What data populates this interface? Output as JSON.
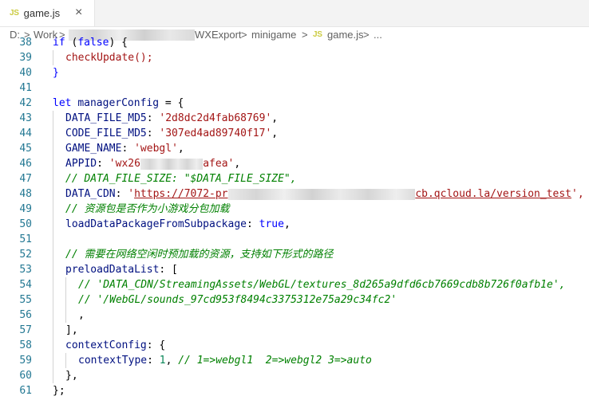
{
  "tab": {
    "icon": "JS",
    "label": "game.js",
    "close_icon": "×"
  },
  "breadcrumb": {
    "drive": "D:",
    "sep": ">",
    "folder1": "Work",
    "folder2": "WXExport",
    "folder3": "minigame",
    "file_icon": "JS",
    "file": "game.js",
    "more": "..."
  },
  "lines": [
    {
      "n": "38",
      "indent": 1,
      "tokens": [
        {
          "t": "if ",
          "c": "kw"
        },
        {
          "t": "(",
          "c": ""
        },
        {
          "t": "false",
          "c": "kw"
        },
        {
          "t": ") {",
          "c": ""
        }
      ]
    },
    {
      "n": "39",
      "indent": 2,
      "tokens": [
        {
          "t": "checkUpdate",
          "c": "str"
        },
        {
          "t": "();",
          "c": "str"
        }
      ]
    },
    {
      "n": "40",
      "indent": 1,
      "tokens": [
        {
          "t": "}",
          "c": "kw"
        }
      ]
    },
    {
      "n": "41",
      "indent": 1,
      "tokens": []
    },
    {
      "n": "42",
      "indent": 1,
      "tokens": [
        {
          "t": "let ",
          "c": "kw"
        },
        {
          "t": "managerConfig",
          "c": "var"
        },
        {
          "t": " = {",
          "c": ""
        }
      ]
    },
    {
      "n": "43",
      "indent": 2,
      "tokens": [
        {
          "t": "DATA_FILE_MD5",
          "c": "var"
        },
        {
          "t": ": ",
          "c": ""
        },
        {
          "t": "'2d8dc2d4fab68769'",
          "c": "str"
        },
        {
          "t": ",",
          "c": ""
        }
      ]
    },
    {
      "n": "44",
      "indent": 2,
      "tokens": [
        {
          "t": "CODE_FILE_MD5",
          "c": "var"
        },
        {
          "t": ": ",
          "c": ""
        },
        {
          "t": "'307ed4ad89740f17'",
          "c": "str"
        },
        {
          "t": ",",
          "c": ""
        }
      ]
    },
    {
      "n": "45",
      "indent": 2,
      "tokens": [
        {
          "t": "GAME_NAME",
          "c": "var"
        },
        {
          "t": ": ",
          "c": ""
        },
        {
          "t": "'webgl'",
          "c": "str"
        },
        {
          "t": ",",
          "c": ""
        }
      ]
    },
    {
      "n": "46",
      "indent": 2,
      "tokens": [
        {
          "t": "APPID",
          "c": "var"
        },
        {
          "t": ": ",
          "c": ""
        },
        {
          "t": "'wx26",
          "c": "str"
        },
        {
          "t": "          ",
          "c": "blur"
        },
        {
          "t": "afea'",
          "c": "str"
        },
        {
          "t": ",",
          "c": ""
        }
      ]
    },
    {
      "n": "47",
      "indent": 2,
      "tokens": [
        {
          "t": "// DATA_FILE_SIZE: \"$DATA_FILE_SIZE\",",
          "c": "com"
        }
      ]
    },
    {
      "n": "48",
      "indent": 2,
      "tokens": [
        {
          "t": "DATA_CDN",
          "c": "var"
        },
        {
          "t": ": ",
          "c": ""
        },
        {
          "t": "'",
          "c": "str"
        },
        {
          "t": "https://7072-pr",
          "c": "link"
        },
        {
          "t": "                              ",
          "c": "blur"
        },
        {
          "t": "cb.qcloud.la/version_test",
          "c": "link"
        },
        {
          "t": "',",
          "c": "str"
        }
      ]
    },
    {
      "n": "49",
      "indent": 2,
      "tokens": [
        {
          "t": "// 资源包是否作为小游戏分包加载",
          "c": "com"
        }
      ]
    },
    {
      "n": "50",
      "indent": 2,
      "tokens": [
        {
          "t": "loadDataPackageFromSubpackage",
          "c": "var"
        },
        {
          "t": ": ",
          "c": ""
        },
        {
          "t": "true",
          "c": "kw"
        },
        {
          "t": ",",
          "c": ""
        }
      ]
    },
    {
      "n": "51",
      "indent": 2,
      "tokens": []
    },
    {
      "n": "52",
      "indent": 2,
      "tokens": [
        {
          "t": "// 需要在网络空闲时预加载的资源，支持如下形式的路径",
          "c": "com"
        }
      ]
    },
    {
      "n": "53",
      "indent": 2,
      "tokens": [
        {
          "t": "preloadDataList",
          "c": "var"
        },
        {
          "t": ": [",
          "c": ""
        }
      ]
    },
    {
      "n": "54",
      "indent": 3,
      "tokens": [
        {
          "t": "// 'DATA_CDN/StreamingAssets/WebGL/textures_8d265a9dfd6cb7669cdb8b726f0afb1e',",
          "c": "com"
        }
      ]
    },
    {
      "n": "55",
      "indent": 3,
      "tokens": [
        {
          "t": "// '/WebGL/sounds_97cd953f8494c3375312e75a29c34fc2'",
          "c": "com"
        }
      ]
    },
    {
      "n": "56",
      "indent": 3,
      "tokens": [
        {
          "t": ",",
          "c": ""
        }
      ]
    },
    {
      "n": "57",
      "indent": 2,
      "tokens": [
        {
          "t": "],",
          "c": ""
        }
      ]
    },
    {
      "n": "58",
      "indent": 2,
      "tokens": [
        {
          "t": "contextConfig",
          "c": "var"
        },
        {
          "t": ": {",
          "c": ""
        }
      ]
    },
    {
      "n": "59",
      "indent": 3,
      "tokens": [
        {
          "t": "contextType",
          "c": "var"
        },
        {
          "t": ": ",
          "c": ""
        },
        {
          "t": "1",
          "c": "num"
        },
        {
          "t": ", ",
          "c": ""
        },
        {
          "t": "// 1=>webgl1  2=>webgl2 3=>auto",
          "c": "com"
        }
      ]
    },
    {
      "n": "60",
      "indent": 2,
      "tokens": [
        {
          "t": "},",
          "c": ""
        }
      ]
    },
    {
      "n": "61",
      "indent": 1,
      "tokens": [
        {
          "t": "};",
          "c": ""
        }
      ]
    }
  ],
  "colors": {
    "keyword": "#0000ff",
    "variable": "#001080",
    "string": "#a31515",
    "function": "#795e26",
    "number": "#098658",
    "comment": "#008000",
    "line_number": "#237893",
    "js_badge": "#cbcb41"
  }
}
